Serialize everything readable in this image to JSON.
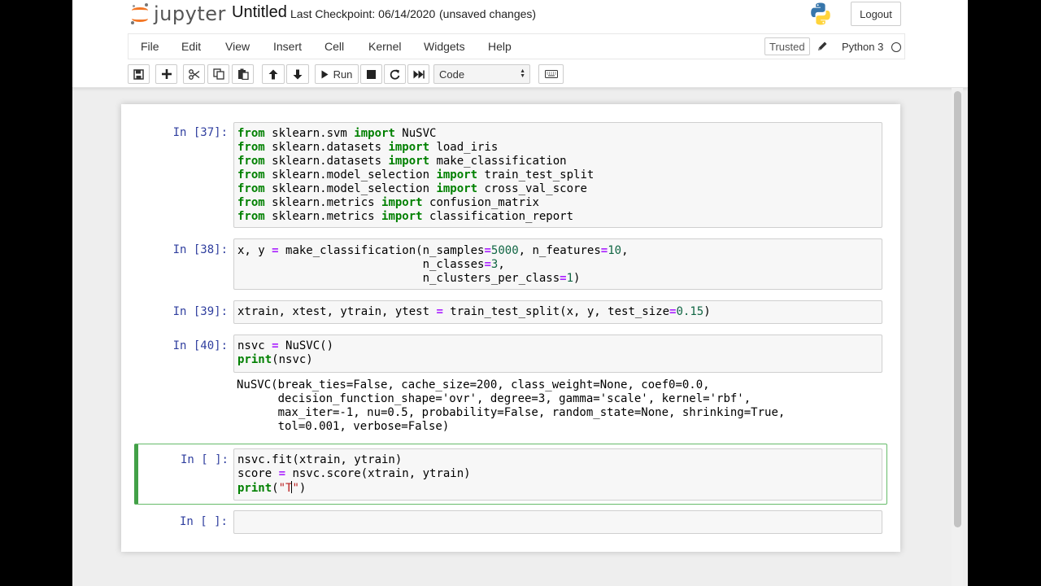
{
  "header": {
    "logo_text": "jupyter",
    "notebook_title": "Untitled",
    "checkpoint": "Last Checkpoint: 06/14/2020",
    "unsaved": "(unsaved changes)",
    "logout": "Logout"
  },
  "menubar": {
    "items": [
      "File",
      "Edit",
      "View",
      "Insert",
      "Cell",
      "Kernel",
      "Widgets",
      "Help"
    ],
    "trusted": "Trusted",
    "kernel": "Python 3"
  },
  "toolbar": {
    "run_label": "Run",
    "cell_type": "Code",
    "icons": [
      "save-icon",
      "plus-icon",
      "scissors-icon",
      "copy-icon",
      "paste-icon",
      "arrow-up-icon",
      "arrow-down-icon",
      "play-icon",
      "stop-icon",
      "restart-icon",
      "fast-forward-icon",
      "keyboard-icon"
    ]
  },
  "cells": [
    {
      "prompt": "In [37]:",
      "lines": [
        "from sklearn.svm import NuSVC",
        "from sklearn.datasets import load_iris",
        "from sklearn.datasets import make_classification",
        "from sklearn.model_selection import train_test_split",
        "from sklearn.model_selection import cross_val_score",
        "from sklearn.metrics import confusion_matrix",
        "from sklearn.metrics import classification_report"
      ]
    },
    {
      "prompt": "In [38]:",
      "lines": [
        "x, y = make_classification(n_samples=5000, n_features=10,",
        "                           n_classes=3,",
        "                           n_clusters_per_class=1)"
      ]
    },
    {
      "prompt": "In [39]:",
      "lines": [
        "xtrain, xtest, ytrain, ytest = train_test_split(x, y, test_size=0.15)"
      ]
    },
    {
      "prompt": "In [40]:",
      "lines": [
        "nsvc = NuSVC()",
        "print(nsvc)"
      ],
      "output": [
        "NuSVC(break_ties=False, cache_size=200, class_weight=None, coef0=0.0,",
        "      decision_function_shape='ovr', degree=3, gamma='scale', kernel='rbf',",
        "      max_iter=-1, nu=0.5, probability=False, random_state=None, shrinking=True,",
        "      tol=0.001, verbose=False)"
      ]
    },
    {
      "prompt": "In [ ]:",
      "lines": [
        "nsvc.fit(xtrain, ytrain)",
        "score = nsvc.score(xtrain, ytrain)",
        "print(\"T\")"
      ]
    },
    {
      "prompt": "In [ ]:",
      "lines": []
    }
  ]
}
